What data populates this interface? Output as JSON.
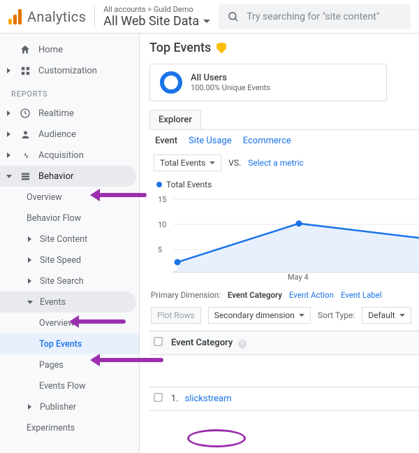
{
  "header": {
    "product": "Analytics",
    "breadcrumb": "All accounts > Guild Demo",
    "view": "All Web Site Data",
    "search_placeholder": "Try searching for \"site content\""
  },
  "sidebar": {
    "home": "Home",
    "customization": "Customization",
    "reports_label": "REPORTS",
    "realtime": "Realtime",
    "audience": "Audience",
    "acquisition": "Acquisition",
    "behavior": {
      "label": "Behavior",
      "overview": "Overview",
      "flow": "Behavior Flow",
      "site_content": "Site Content",
      "site_speed": "Site Speed",
      "site_search": "Site Search",
      "events": {
        "label": "Events",
        "overview": "Overview",
        "top_events": "Top Events",
        "pages": "Pages",
        "events_flow": "Events Flow"
      },
      "publisher": "Publisher",
      "experiments": "Experiments"
    }
  },
  "main": {
    "title": "Top Events",
    "segment": {
      "name": "All Users",
      "detail": "100.00% Unique Events"
    },
    "tab": "Explorer",
    "subtabs": {
      "event": "Event",
      "site_usage": "Site Usage",
      "ecommerce": "Ecommerce"
    },
    "metric_selector": "Total Events",
    "vs": "VS.",
    "select_metric": "Select a metric",
    "legend": "Total Events",
    "primary_dimension": {
      "label": "Primary Dimension:",
      "active": "Event Category",
      "action": "Event Action",
      "elabel": "Event Label"
    },
    "controls": {
      "plot_rows": "Plot Rows",
      "secondary_dim": "Secondary dimension",
      "sort_label": "Sort Type:",
      "sort_value": "Default"
    },
    "table": {
      "header": "Event Category",
      "rows": [
        {
          "n": "1.",
          "value": "slickstream"
        }
      ]
    }
  },
  "chart_data": {
    "type": "area",
    "title": "Total Events",
    "ylabel": "",
    "y_ticks": [
      5,
      10,
      15
    ],
    "ylim": [
      0,
      15
    ],
    "x_tick_labels": [
      "May 4"
    ],
    "series": [
      {
        "name": "Total Events",
        "color": "#1a73e8",
        "values": [
          2,
          10,
          7
        ]
      }
    ]
  }
}
